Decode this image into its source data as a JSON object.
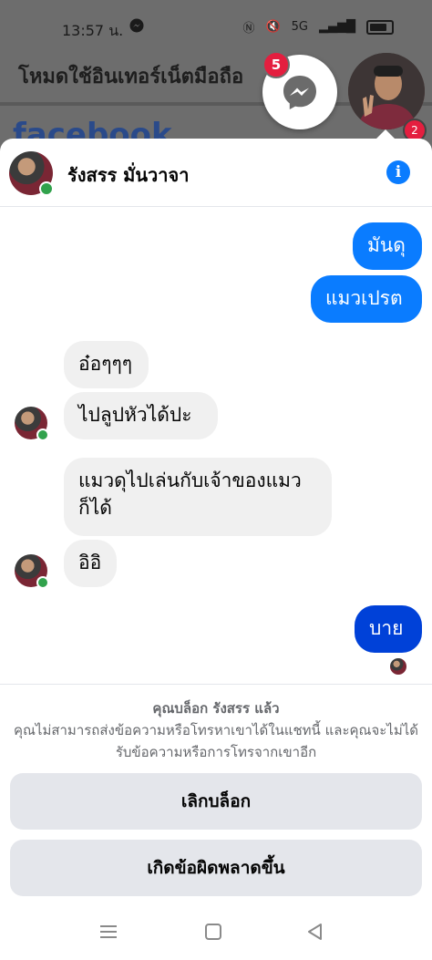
{
  "status_bar": {
    "time": "13:57 น.",
    "network": "5G"
  },
  "background": {
    "page_title": "โหมดใช้อินเทอร์เน็ตมือถือ",
    "app_logo_text": "facebook"
  },
  "chat_heads": {
    "messenger_badge": "5",
    "profile_badge": "2"
  },
  "chat": {
    "contact_name": "รังสรร มั่นวาจา",
    "messages": [
      {
        "text": "มันดุ"
      },
      {
        "text": "แมวเปรต"
      },
      {
        "text": "อ๋อๆๆๆ"
      },
      {
        "text": "ไปลูปหัวได้ปะ"
      },
      {
        "text": "แมวดุไปเล่นกับเจ้าของแมว\nก็ได้"
      },
      {
        "text": "อิอิ"
      },
      {
        "text": "บาย"
      }
    ]
  },
  "block_notice": {
    "title": "คุณบล็อก รังสรร แล้ว",
    "description": "คุณไม่สามารถส่งข้อความหรือโทรหาเขาได้ในแชทนี้ และคุณจะไม่ได้รับข้อความหรือการโทรจากเขาอีก",
    "unblock_label": "เลิกบล็อก",
    "report_label": "เกิดข้อผิดพลาดขึ้น"
  },
  "colors": {
    "accent": "#0a7cff",
    "last_sent": "#0041d8",
    "online": "#31a24c",
    "badge": "#e41e3f"
  }
}
